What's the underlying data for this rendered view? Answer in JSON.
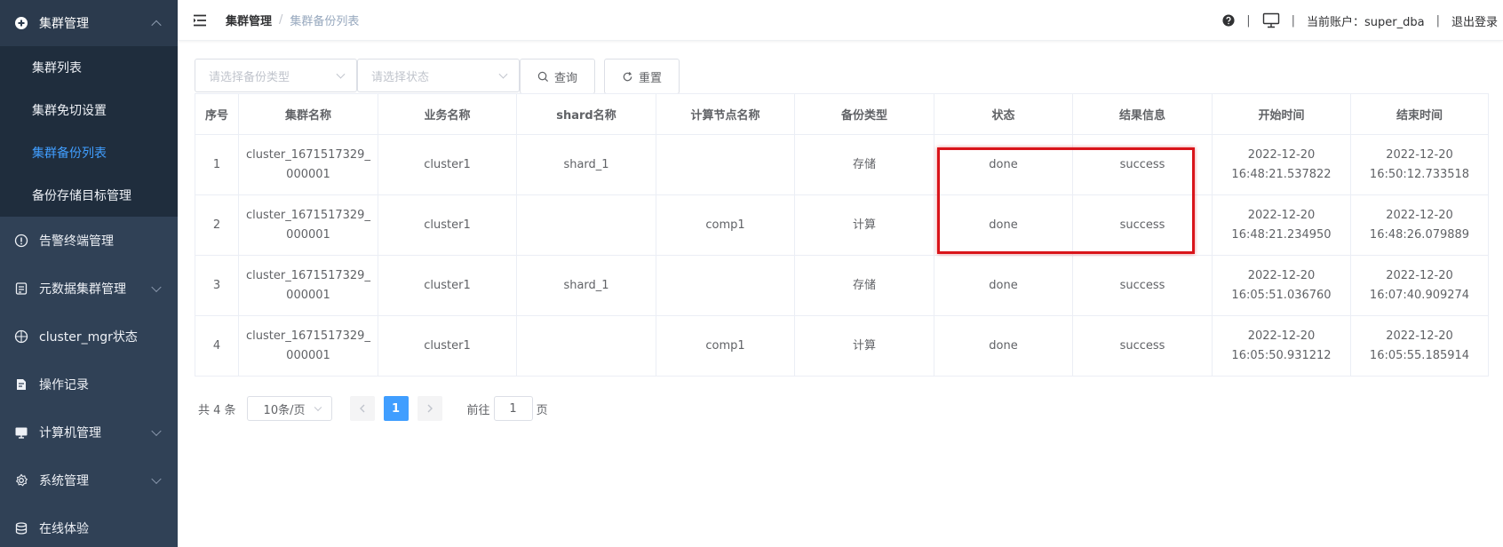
{
  "sidebar": {
    "group_title": "集群管理",
    "sub_items": [
      "集群列表",
      "集群免切设置",
      "集群备份列表",
      "备份存储目标管理"
    ],
    "items": [
      "告警终端管理",
      "元数据集群管理",
      "cluster_mgr状态",
      "操作记录",
      "计算机管理",
      "系统管理",
      "在线体验"
    ]
  },
  "header": {
    "breadcrumb_1": "集群管理",
    "breadcrumb_sep": "/",
    "breadcrumb_2": "集群备份列表",
    "pipe": "|",
    "account_label": "当前账户：super_dba",
    "logout": "退出登录"
  },
  "filters": {
    "backup_type_placeholder": "请选择备份类型",
    "status_placeholder": "请选择状态",
    "query_label": "查询",
    "reset_label": "重置"
  },
  "table": {
    "headers": [
      "序号",
      "集群名称",
      "业务名称",
      "shard名称",
      "计算节点名称",
      "备份类型",
      "状态",
      "结果信息",
      "开始时间",
      "结束时间"
    ],
    "rows": [
      {
        "idx": "1",
        "cluster": "cluster_1671517329_000001",
        "biz": "cluster1",
        "shard": "shard_1",
        "comp": "",
        "type": "存储",
        "status": "done",
        "result": "success",
        "start": "2022-12-20 16:48:21.537822",
        "end": "2022-12-20 16:50:12.733518"
      },
      {
        "idx": "2",
        "cluster": "cluster_1671517329_000001",
        "biz": "cluster1",
        "shard": "",
        "comp": "comp1",
        "type": "计算",
        "status": "done",
        "result": "success",
        "start": "2022-12-20 16:48:21.234950",
        "end": "2022-12-20 16:48:26.079889"
      },
      {
        "idx": "3",
        "cluster": "cluster_1671517329_000001",
        "biz": "cluster1",
        "shard": "shard_1",
        "comp": "",
        "type": "存储",
        "status": "done",
        "result": "success",
        "start": "2022-12-20 16:05:51.036760",
        "end": "2022-12-20 16:07:40.909274"
      },
      {
        "idx": "4",
        "cluster": "cluster_1671517329_000001",
        "biz": "cluster1",
        "shard": "",
        "comp": "comp1",
        "type": "计算",
        "status": "done",
        "result": "success",
        "start": "2022-12-20 16:05:50.931212",
        "end": "2022-12-20 16:05:55.185914"
      }
    ]
  },
  "pagination": {
    "total": "共 4 条",
    "page_size": "10条/页",
    "current": "1",
    "goto_prefix": "前往",
    "goto_value": "1",
    "goto_suffix": "页"
  },
  "colors": {
    "sidebar_bg": "#304156",
    "accent": "#409eff",
    "highlight": "#d9141a"
  }
}
